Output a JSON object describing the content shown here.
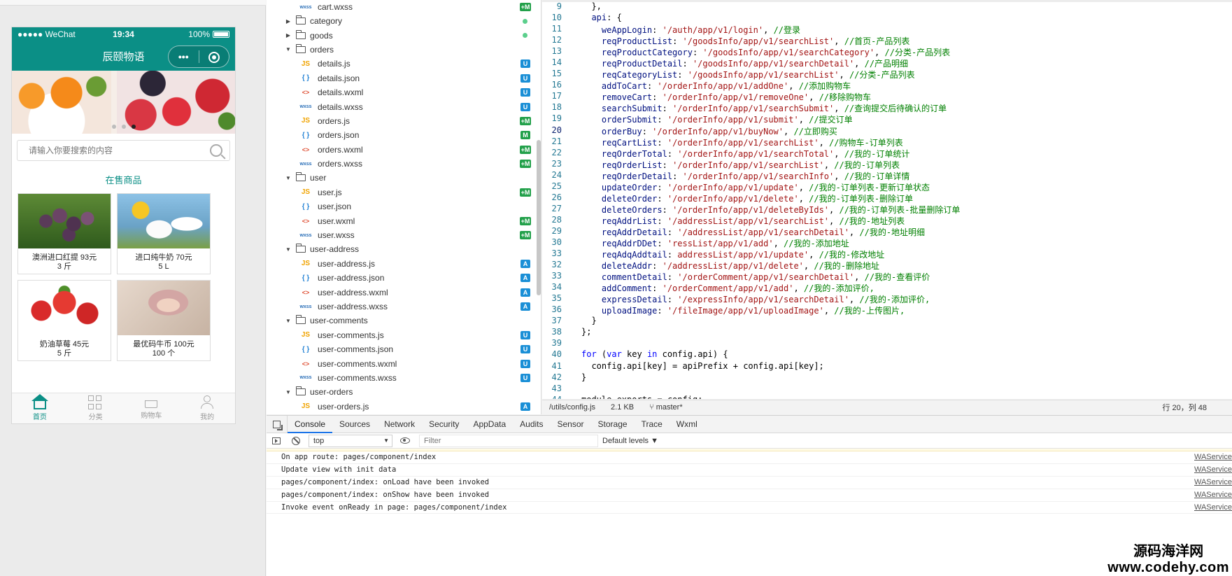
{
  "simulator": {
    "status": {
      "carrier": "●●●●● WeChat",
      "time": "19:34",
      "battery": "100%"
    },
    "nav_title": "辰颐物语",
    "capsule_more": "•••",
    "search_placeholder": "请输入你要搜索的内容",
    "section_title": "在售商品",
    "products": [
      {
        "name": "澳洲进口红提 93元",
        "qty": "3 斤"
      },
      {
        "name": "进口纯牛奶 70元",
        "qty": "5 L"
      },
      {
        "name": "奶油草莓 45元",
        "qty": "5 斤"
      },
      {
        "name": "最优码牛币 100元",
        "qty": "100 个"
      }
    ],
    "tabs": [
      {
        "label": "首页",
        "icon": "home-icon"
      },
      {
        "label": "分类",
        "icon": "category-icon"
      },
      {
        "label": "购物车",
        "icon": "cart-icon"
      },
      {
        "label": "我的",
        "icon": "user-icon"
      }
    ]
  },
  "file_tree": [
    {
      "type": "file",
      "name": "cart.wxss",
      "ext": "wxss",
      "badge": "+M"
    },
    {
      "type": "folder",
      "name": "category",
      "open": false,
      "dot": true
    },
    {
      "type": "folder",
      "name": "goods",
      "open": false,
      "dot": true
    },
    {
      "type": "folder",
      "name": "orders",
      "open": true
    },
    {
      "type": "file",
      "name": "details.js",
      "ext": "js",
      "badge": "U"
    },
    {
      "type": "file",
      "name": "details.json",
      "ext": "json",
      "badge": "U"
    },
    {
      "type": "file",
      "name": "details.wxml",
      "ext": "wxml",
      "badge": "U"
    },
    {
      "type": "file",
      "name": "details.wxss",
      "ext": "wxss",
      "badge": "U"
    },
    {
      "type": "file",
      "name": "orders.js",
      "ext": "js",
      "badge": "+M"
    },
    {
      "type": "file",
      "name": "orders.json",
      "ext": "json",
      "badge": "M"
    },
    {
      "type": "file",
      "name": "orders.wxml",
      "ext": "wxml",
      "badge": "+M"
    },
    {
      "type": "file",
      "name": "orders.wxss",
      "ext": "wxss",
      "badge": "+M"
    },
    {
      "type": "folder",
      "name": "user",
      "open": true
    },
    {
      "type": "file",
      "name": "user.js",
      "ext": "js",
      "badge": "+M"
    },
    {
      "type": "file",
      "name": "user.json",
      "ext": "json",
      "badge": ""
    },
    {
      "type": "file",
      "name": "user.wxml",
      "ext": "wxml",
      "badge": "+M"
    },
    {
      "type": "file",
      "name": "user.wxss",
      "ext": "wxss",
      "badge": "+M"
    },
    {
      "type": "folder",
      "name": "user-address",
      "open": true
    },
    {
      "type": "file",
      "name": "user-address.js",
      "ext": "js",
      "badge": "A"
    },
    {
      "type": "file",
      "name": "user-address.json",
      "ext": "json",
      "badge": "A"
    },
    {
      "type": "file",
      "name": "user-address.wxml",
      "ext": "wxml",
      "badge": "A"
    },
    {
      "type": "file",
      "name": "user-address.wxss",
      "ext": "wxss",
      "badge": "A"
    },
    {
      "type": "folder",
      "name": "user-comments",
      "open": true
    },
    {
      "type": "file",
      "name": "user-comments.js",
      "ext": "js",
      "badge": "U"
    },
    {
      "type": "file",
      "name": "user-comments.json",
      "ext": "json",
      "badge": "U"
    },
    {
      "type": "file",
      "name": "user-comments.wxml",
      "ext": "wxml",
      "badge": "U"
    },
    {
      "type": "file",
      "name": "user-comments.wxss",
      "ext": "wxss",
      "badge": "U"
    },
    {
      "type": "folder",
      "name": "user-orders",
      "open": true
    },
    {
      "type": "file",
      "name": "user-orders.js",
      "ext": "js",
      "badge": "A"
    }
  ],
  "editor": {
    "current_line": "20",
    "lines": [
      {
        "n": "9",
        "indent": "  ",
        "code": "},",
        "comment": ""
      },
      {
        "n": "10",
        "indent": "  ",
        "key": "api",
        "code": ": {",
        "comment": ""
      },
      {
        "n": "11",
        "indent": "    ",
        "key": "weAppLogin",
        "str": "'/auth/app/v1/login'",
        "comment": "//登录"
      },
      {
        "n": "12",
        "indent": "    ",
        "key": "reqProductList",
        "str": "'/goodsInfo/app/v1/searchList'",
        "comment": "//首页-产品列表"
      },
      {
        "n": "13",
        "indent": "    ",
        "key": "reqProductCategory",
        "str": "'/goodsInfo/app/v1/searchCategory'",
        "comment": "//分类-产品列表"
      },
      {
        "n": "14",
        "indent": "    ",
        "key": "reqProductDetail",
        "str": "'/goodsInfo/app/v1/searchDetail'",
        "comment": "//产品明细"
      },
      {
        "n": "15",
        "indent": "    ",
        "key": "reqCategoryList",
        "str": "'/goodsInfo/app/v1/searchList'",
        "comment": "//分类-产品列表"
      },
      {
        "n": "16",
        "indent": "    ",
        "key": "addToCart",
        "str": "'/orderInfo/app/v1/addOne'",
        "comment": "//添加购物车"
      },
      {
        "n": "17",
        "indent": "    ",
        "key": "removeCart",
        "str": "'/orderInfo/app/v1/removeOne'",
        "comment": "//移除购物车"
      },
      {
        "n": "18",
        "indent": "    ",
        "key": "searchSubmit",
        "str": "'/orderInfo/app/v1/searchSubmit'",
        "comment": "//查询提交后待确认的订单"
      },
      {
        "n": "19",
        "indent": "    ",
        "key": "orderSubmit",
        "str": "'/orderInfo/app/v1/submit'",
        "comment": "//提交订单"
      },
      {
        "n": "20",
        "indent": "    ",
        "key": "orderBuy",
        "str": "'/orderInfo/app/v1/buyNow'",
        "comment": "//立即购买"
      },
      {
        "n": "21",
        "indent": "    ",
        "key": "reqCartList",
        "str": "'/orderInfo/app/v1/searchList'",
        "comment": "//购物车-订单列表"
      },
      {
        "n": "22",
        "indent": "    ",
        "key": "reqOrderTotal",
        "str": "'/orderInfo/app/v1/searchTotal'",
        "comment": "//我的-订单统计"
      },
      {
        "n": "23",
        "indent": "    ",
        "key": "reqOrderList",
        "str": "'/orderInfo/app/v1/searchList'",
        "comment": "//我的-订单列表"
      },
      {
        "n": "24",
        "indent": "    ",
        "key": "reqOrderDetail",
        "str": "'/orderInfo/app/v1/searchInfo'",
        "comment": "//我的-订单详情"
      },
      {
        "n": "25",
        "indent": "    ",
        "key": "updateOrder",
        "str": "'/orderInfo/app/v1/update'",
        "comment": "//我的-订单列表-更新订单状态"
      },
      {
        "n": "26",
        "indent": "    ",
        "key": "deleteOrder",
        "str": "'/orderInfo/app/v1/delete'",
        "comment": "//我的-订单列表-删除订单"
      },
      {
        "n": "27",
        "indent": "    ",
        "key": "deleteOrders",
        "str": "'/orderInfo/app/v1/deleteByIds'",
        "comment": "//我的-订单列表-批量删除订单"
      },
      {
        "n": "28",
        "indent": "    ",
        "key": "reqAddrList",
        "str": "'/addressList/app/v1/searchList'",
        "comment": "//我的-地址列表"
      },
      {
        "n": "29",
        "indent": "    ",
        "key": "reqAddrDetail",
        "str": "'/addressList/app/v1/searchDetail'",
        "comment": "//我的-地址明细"
      },
      {
        "n": "30",
        "indent": "    ",
        "key": "reqAddrDDet",
        "str": "'ressList/app/v1/add'",
        "comment": "//我的-添加地址"
      },
      {
        "n": "33",
        "indent": "    ",
        "key": "reqAdqAddtail",
        "str": "addressList/app/v1/update'",
        "comment": "//我的-修改地址"
      },
      {
        "n": "32",
        "indent": "    ",
        "key": "deleteAddr",
        "str": "'/addressList/app/v1/delete'",
        "comment": "//我的-删除地址"
      },
      {
        "n": "33",
        "indent": "    ",
        "key": "commentDetail",
        "str": "'/orderComment/app/v1/searchDetail'",
        "comment": "//我的-查看评价"
      },
      {
        "n": "34",
        "indent": "    ",
        "key": "addComment",
        "str": "'/orderComment/app/v1/add'",
        "comment": "//我的-添加评价,"
      },
      {
        "n": "35",
        "indent": "    ",
        "key": "expressDetail",
        "str": "'/expressInfo/app/v1/searchDetail'",
        "comment": "//我的-添加评价,"
      },
      {
        "n": "36",
        "indent": "    ",
        "key": "uploadImage",
        "str": "'/fileImage/app/v1/uploadImage'",
        "comment": "//我的-上传图片,"
      },
      {
        "n": "37",
        "indent": "  ",
        "code": "}",
        "comment": ""
      },
      {
        "n": "38",
        "indent": "",
        "code": "};",
        "comment": ""
      },
      {
        "n": "39",
        "indent": "",
        "code": "",
        "comment": ""
      },
      {
        "n": "40",
        "indent": "",
        "kw": "for",
        "code": " (",
        "kw2": "var",
        "code2": " key ",
        "kw3": "in",
        "code3": " config.api) {",
        "comment": ""
      },
      {
        "n": "41",
        "indent": "  ",
        "code": "config.api[key] = apiPrefix + config.api[key];",
        "comment": ""
      },
      {
        "n": "42",
        "indent": "",
        "code": "}",
        "comment": ""
      },
      {
        "n": "43",
        "indent": "",
        "code": "",
        "comment": ""
      },
      {
        "n": "44",
        "indent": "",
        "code": "module.exports = config;",
        "comment": ""
      }
    ],
    "status": {
      "file": "/utils/config.js",
      "size": "2.1 KB",
      "branch": "master*",
      "position": "行 20，列 48"
    }
  },
  "console": {
    "tabs": [
      "Console",
      "Sources",
      "Network",
      "Security",
      "AppData",
      "Audits",
      "Sensor",
      "Storage",
      "Trace",
      "Wxml"
    ],
    "active_tab": "Console",
    "context": "top",
    "filter_placeholder": "Filter",
    "levels": "Default levels ▼",
    "logs": [
      {
        "text": "On app route: pages/component/index",
        "source": "WAService"
      },
      {
        "text": "Update view with init data",
        "source": "WAService"
      },
      {
        "text": "pages/component/index: onLoad have been invoked",
        "source": "WAService"
      },
      {
        "text": "pages/component/index: onShow have been invoked",
        "source": "WAService"
      },
      {
        "text": "Invoke event onReady in page: pages/component/index",
        "source": "WAService"
      }
    ]
  },
  "watermark": {
    "line1": "源码海洋网",
    "line2": "www.codehy.com"
  },
  "colors": {
    "brand": "#0b8f86",
    "badge_blue": "#1a8fd6",
    "badge_green": "#22a04a"
  }
}
